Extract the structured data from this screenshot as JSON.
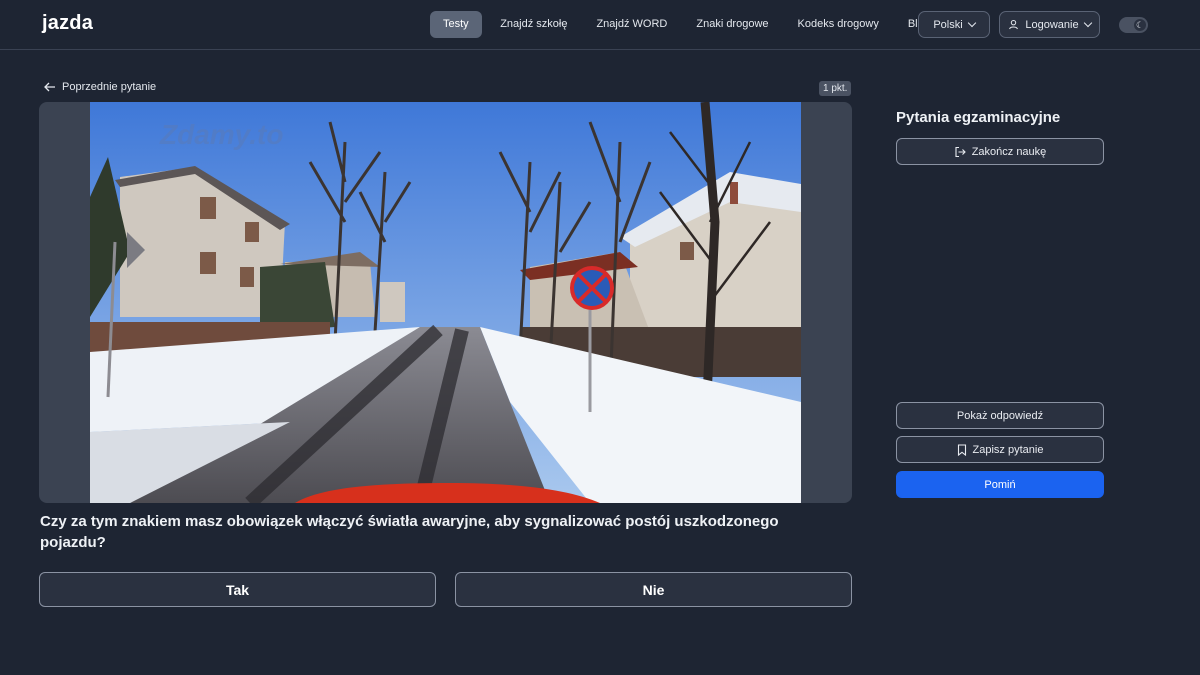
{
  "header": {
    "logo": "jazda",
    "nav": [
      "Testy",
      "Znajdź szkołę",
      "Znajdź WORD",
      "Znaki drogowe",
      "Kodeks drogowy",
      "Blog"
    ],
    "language": "Polski",
    "login": "Logowanie",
    "theme_icon": "moon-icon"
  },
  "question_view": {
    "back_label": "Poprzednie pytanie",
    "points": "1 pkt.",
    "watermark": "Zdamy.to",
    "question_text": "Czy za tym znakiem masz obowiązek włączyć światła awaryjne, aby sygnalizować postój uszkodzonego pojazdu?",
    "answers": [
      "Tak",
      "Nie"
    ]
  },
  "side_panel": {
    "title": "Pytania egzaminacyjne",
    "finish_label": "Zakończ naukę",
    "show_answer_label": "Pokaż odpowiedź",
    "save_question_label": "Zapisz pytanie",
    "skip_label": "Pomiń"
  },
  "colors": {
    "background": "#1e2533",
    "primary": "#1b63f0",
    "button_bg": "#2a3140"
  }
}
